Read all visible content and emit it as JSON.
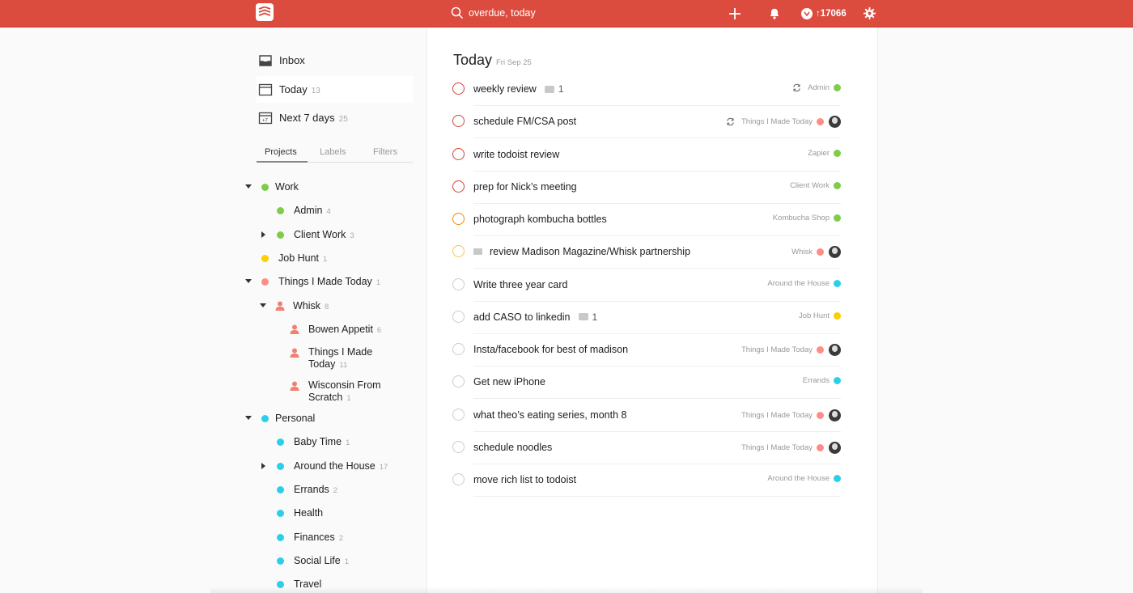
{
  "topbar": {
    "search_text": "overdue, today",
    "karma_value": "↑17066",
    "colors": {
      "bar": "#db4c3f"
    }
  },
  "sidebar": {
    "nav": [
      {
        "label": "Inbox",
        "count": "",
        "icon": "inbox-icon"
      },
      {
        "label": "Today",
        "count": "13",
        "icon": "calendar-icon"
      },
      {
        "label": "Next 7 days",
        "count": "25",
        "icon": "calendar-week-icon"
      }
    ],
    "week_icon_text": "+7",
    "tabs": [
      "Projects",
      "Labels",
      "Filters"
    ],
    "projects": [
      {
        "name": "Work",
        "count": "",
        "color": "#7ecc49"
      },
      {
        "name": "Admin",
        "count": "4",
        "color": "#7ecc49"
      },
      {
        "name": "Client Work",
        "count": "3",
        "color": "#7ecc49"
      },
      {
        "name": "Job Hunt",
        "count": "1",
        "color": "#fad000"
      },
      {
        "name": "Things I Made Today",
        "count": "1",
        "color": "#ff8d85"
      },
      {
        "name": "Whisk",
        "count": "8",
        "color": "#ff8d85"
      },
      {
        "name": "Bowen Appetit",
        "count": "6",
        "color": "#ff8d85"
      },
      {
        "name_line1": "Things I Made",
        "name_line2": "Today",
        "count": "11",
        "color": "#ff8d85"
      },
      {
        "name_line1": "Wisconsin From",
        "name_line2": "Scratch",
        "count": "1",
        "color": "#ff8d85"
      },
      {
        "name": "Personal",
        "count": "",
        "color": "#2ccfe9"
      },
      {
        "name": "Baby Time",
        "count": "1",
        "color": "#2ccfe9"
      },
      {
        "name": "Around the House",
        "count": "17",
        "color": "#2ccfe9"
      },
      {
        "name": "Errands",
        "count": "2",
        "color": "#2ccfe9"
      },
      {
        "name": "Health",
        "count": "",
        "color": "#2ccfe9"
      },
      {
        "name": "Finances",
        "count": "2",
        "color": "#2ccfe9"
      },
      {
        "name": "Social Life",
        "count": "1",
        "color": "#2ccfe9"
      },
      {
        "name": "Travel",
        "count": "",
        "color": "#2ccfe9"
      }
    ]
  },
  "main": {
    "title": "Today",
    "date": "Fri Sep 25",
    "tasks": [
      {
        "text": "weekly review",
        "comments": "1",
        "project": "Admin",
        "color": "#7ecc49",
        "priority": "#d1453b",
        "recurring": true,
        "avatar": false,
        "mail": false
      },
      {
        "text": "schedule FM/CSA post",
        "comments": "",
        "project": "Things I Made Today",
        "color": "#ff8d85",
        "priority": "#d1453b",
        "recurring": true,
        "avatar": true,
        "mail": false
      },
      {
        "text": "write todoist review",
        "comments": "",
        "project": "Zapier",
        "color": "#7ecc49",
        "priority": "#d1453b",
        "recurring": false,
        "avatar": false,
        "mail": false
      },
      {
        "text": "prep for Nick’s meeting",
        "comments": "",
        "project": "Client Work",
        "color": "#7ecc49",
        "priority": "#d1453b",
        "recurring": false,
        "avatar": false,
        "mail": false
      },
      {
        "text": "photograph kombucha bottles",
        "comments": "",
        "project": "Kombucha Shop",
        "color": "#7ecc49",
        "priority": "#eb8909",
        "recurring": false,
        "avatar": false,
        "mail": false
      },
      {
        "text": "review Madison Magazine/Whisk partnership",
        "comments": "",
        "project": "Whisk",
        "color": "#ff8d85",
        "priority": "#f9c34c",
        "recurring": false,
        "avatar": true,
        "mail": true
      },
      {
        "text": "Write three year card",
        "comments": "",
        "project": "Around the House",
        "color": "#2ccfe9",
        "priority": "#cccccc",
        "recurring": false,
        "avatar": false,
        "mail": false
      },
      {
        "text": "add CASO to linkedin",
        "comments": "1",
        "project": "Job Hunt",
        "color": "#fad000",
        "priority": "#cccccc",
        "recurring": false,
        "avatar": false,
        "mail": false
      },
      {
        "text": "Insta/facebook for best of madison",
        "comments": "",
        "project": "Things I Made Today",
        "color": "#ff8d85",
        "priority": "#cccccc",
        "recurring": false,
        "avatar": true,
        "mail": false
      },
      {
        "text": "Get new iPhone",
        "comments": "",
        "project": "Errands",
        "color": "#2ccfe9",
        "priority": "#cccccc",
        "recurring": false,
        "avatar": false,
        "mail": false
      },
      {
        "text": "what theo’s eating series, month 8",
        "comments": "",
        "project": "Things I Made Today",
        "color": "#ff8d85",
        "priority": "#cccccc",
        "recurring": false,
        "avatar": true,
        "mail": false
      },
      {
        "text": "schedule noodles",
        "comments": "",
        "project": "Things I Made Today",
        "color": "#ff8d85",
        "priority": "#cccccc",
        "recurring": false,
        "avatar": true,
        "mail": false
      },
      {
        "text": "move rich list to todoist",
        "comments": "",
        "project": "Around the House",
        "color": "#2ccfe9",
        "priority": "#cccccc",
        "recurring": false,
        "avatar": false,
        "mail": false
      }
    ]
  }
}
